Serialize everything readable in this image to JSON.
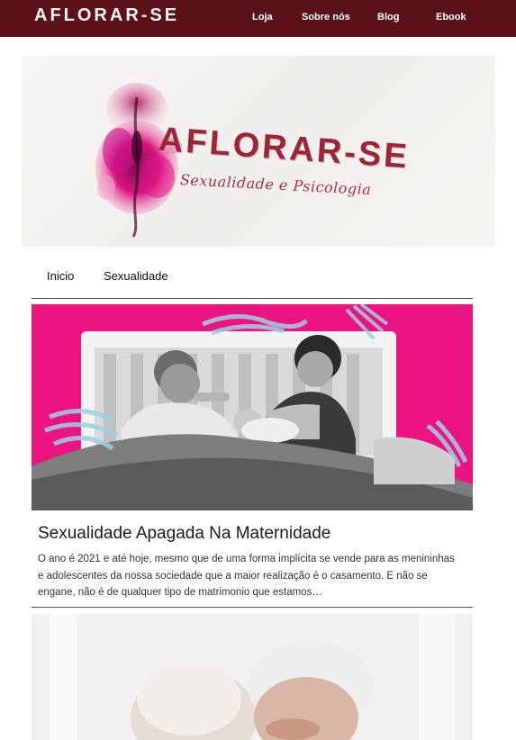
{
  "topbar": {
    "brand": "AFLORAR-SE",
    "links": [
      "Loja",
      "Sobre nós",
      "Blog",
      "Ebook"
    ]
  },
  "banner": {
    "title": "AFLORAR-SE",
    "subtitle": "Sexualidade e Psicologia"
  },
  "subnav": {
    "items": [
      "Inicio",
      "Sexualidade"
    ]
  },
  "article": {
    "title": "Sexualidade Apagada Na Maternidade",
    "excerpt": "O ano é 2021 e até hoje, mesmo que de uma forma implícita se vende para as menininhas e adolescentes da nossa sociedade que a maior realização é o casamento. E não se engane, não é de qualquer tipo de matrimonio que estamos…"
  },
  "colors": {
    "topbar": "#5a1117",
    "accent": "#9b2637",
    "article_image_bg": "#ec1481"
  }
}
